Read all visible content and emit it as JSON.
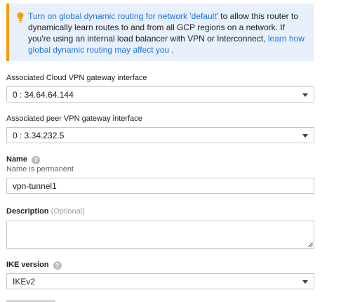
{
  "banner": {
    "link1": "Turn on global dynamic routing for network 'default'",
    "text1": " to allow this router to dynamically learn routes to and from all GCP regions on a network. If you're using an internal load balancer with VPN or Interconnect, ",
    "link2": "learn how global dynamic routing may affect you",
    "text2": " ."
  },
  "cloud_vpn": {
    "label": "Associated Cloud VPN gateway interface",
    "value": "0 : 34.64.64.144"
  },
  "peer_vpn": {
    "label": "Associated peer VPN gateway interface",
    "value": "0 : 3.34.232.5"
  },
  "name": {
    "label": "Name",
    "hint": "Name is permanent",
    "value": "vpn-tunnel1"
  },
  "description": {
    "label": "Description",
    "optional": "(Optional)",
    "value": ""
  },
  "ike": {
    "label": "IKE version",
    "value": "IKEv2"
  },
  "icons": {
    "banner": "lightbulb-icon",
    "help": "help-circle-icon",
    "dropdown": "chevron-down-icon"
  },
  "colors": {
    "banner_bg": "#e8f0fb",
    "banner_accent": "#f29d0a",
    "link": "#1a73e8"
  }
}
